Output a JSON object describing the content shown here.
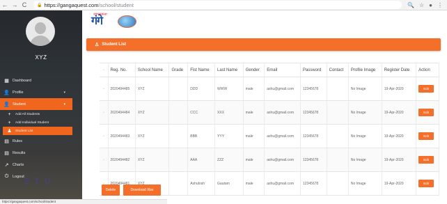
{
  "browser": {
    "url_host": "https://gangaquest.com",
    "url_path": "/school/student",
    "back_glyph": "←",
    "forward_glyph": "→",
    "reload_glyph": "C",
    "lock_glyph": "🔒",
    "search_glyph": "🔍",
    "star_glyph": "☆",
    "account_glyph": "●",
    "menu_glyph": "⋮"
  },
  "sidebar": {
    "user_name": "XYZ",
    "items": [
      {
        "label": "Dashboard",
        "icon": "dashboard-icon",
        "glyph": "▦"
      },
      {
        "label": "Profile",
        "icon": "user-icon",
        "glyph": "👤",
        "caret": "▾"
      },
      {
        "label": "Student",
        "icon": "user-icon",
        "glyph": "👤",
        "caret": "▾"
      },
      {
        "label": "Add All Students",
        "icon": "add-users-icon",
        "glyph": "+"
      },
      {
        "label": "Add Individual Student",
        "icon": "add-user-icon",
        "glyph": "+"
      },
      {
        "label": "Student List",
        "icon": "user-icon",
        "glyph": "♟"
      },
      {
        "label": "Rules",
        "icon": "rules-icon",
        "glyph": "▤"
      },
      {
        "label": "Results",
        "icon": "results-icon",
        "glyph": "▤"
      },
      {
        "label": "Charts",
        "icon": "chart-icon",
        "glyph": "↗"
      },
      {
        "label": "Logout",
        "icon": "logout-icon",
        "glyph": "⏻"
      }
    ],
    "watermark": "S T U"
  },
  "logo": {
    "text": "गंगे",
    "sub": "जागरूकता"
  },
  "panel": {
    "title": "Student List",
    "icon_glyph": "♙"
  },
  "table": {
    "headers": [
      "",
      "Reg. No.",
      "School Name",
      "Grade",
      "Fist Name",
      "Last Name",
      "Gender",
      "Email",
      "Password",
      "Contact",
      "Profile Image",
      "Register Date",
      "Action"
    ],
    "rows": [
      [
        "2020494485",
        "XYZ",
        "",
        "DDD",
        "WWW",
        "male",
        "ashu@gmail.com",
        "12345678",
        "",
        "No Image",
        "19-Apr-2020",
        "Edit"
      ],
      [
        "2020494484",
        "XYZ",
        "",
        "CCC",
        "XXX",
        "male",
        "ashu@gmail.com",
        "12345678",
        "",
        "No Image",
        "19-Apr-2020",
        "Edit"
      ],
      [
        "2020494483",
        "XYZ",
        "",
        "BBB",
        "YYY",
        "male",
        "ashu@gmail.com",
        "12345678",
        "",
        "No Image",
        "19-Apr-2020",
        "Edit"
      ],
      [
        "2020494482",
        "XYZ",
        "",
        "AAA",
        "ZZZ",
        "male",
        "ashu@gmail.com",
        "12345678",
        "",
        "No Image",
        "19-Apr-2020",
        "Edit"
      ],
      [
        "2020494481",
        "XYZ",
        "",
        "Ashutosh",
        "Gautam",
        "male",
        "ashu@gmail.com",
        "12345678",
        "",
        "No Image",
        "19-Apr-2020",
        "Edit"
      ]
    ],
    "checkbox_glyph": "▫"
  },
  "actions": {
    "delete_label": "Delete",
    "download_label": "Download Xlsx"
  },
  "status_bar": {
    "text": "https://gangaquest.com/school/student"
  },
  "colors": {
    "accent": "#f4702a",
    "sidebar": "#2a2e33"
  }
}
